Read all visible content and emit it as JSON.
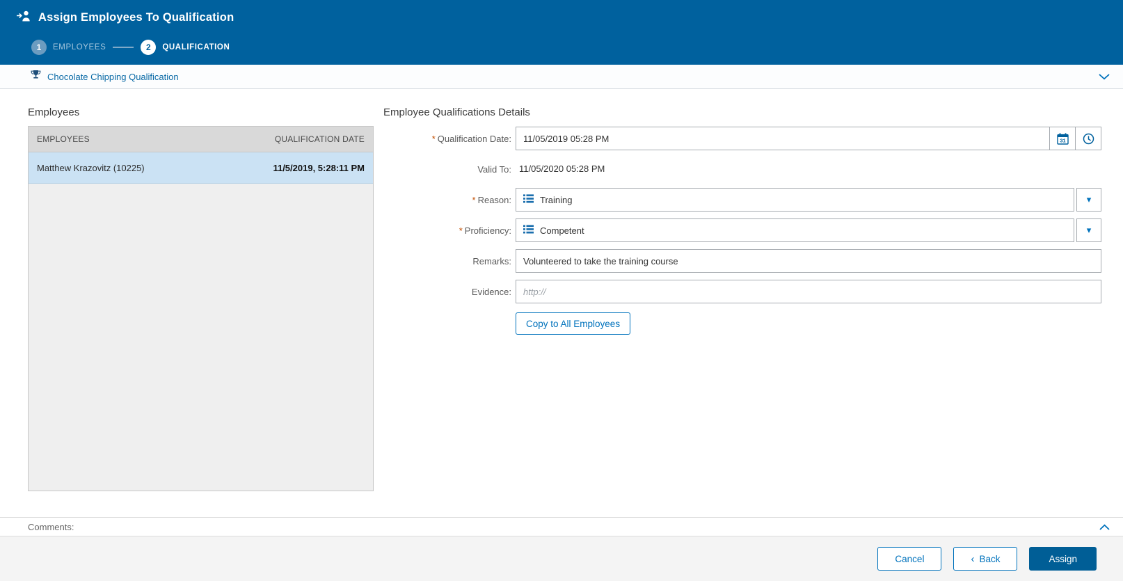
{
  "header": {
    "title": "Assign Employees To Qualification",
    "steps": [
      {
        "number": "1",
        "label": "EMPLOYEES"
      },
      {
        "number": "2",
        "label": "QUALIFICATION"
      }
    ]
  },
  "qualification_bar": {
    "title": "Chocolate Chipping Qualification"
  },
  "employees_panel": {
    "title": "Employees",
    "columns": [
      "EMPLOYEES",
      "QUALIFICATION DATE"
    ],
    "rows": [
      {
        "name": "Matthew Krazovitz (10225)",
        "date": "11/5/2019, 5:28:11 PM"
      }
    ]
  },
  "details_panel": {
    "title": "Employee Qualifications Details",
    "required_mark": "*",
    "qualification_date": {
      "label": "Qualification Date:",
      "value": "11/05/2019 05:28 PM"
    },
    "valid_to": {
      "label": "Valid To:",
      "value": "11/05/2020 05:28 PM"
    },
    "reason": {
      "label": "Reason:",
      "value": "Training"
    },
    "proficiency": {
      "label": "Proficiency:",
      "value": "Competent"
    },
    "remarks": {
      "label": "Remarks:",
      "value": "Volunteered to take the training course"
    },
    "evidence": {
      "label": "Evidence:",
      "placeholder": "http://"
    },
    "copy_button": "Copy to All Employees"
  },
  "comments": {
    "label": "Comments:"
  },
  "footer": {
    "cancel": "Cancel",
    "back": "Back",
    "assign": "Assign"
  },
  "icons": {
    "calendar_day": "31",
    "chevron_left": "‹",
    "caret_down": "▾"
  },
  "colors": {
    "header_bg": "#00619E",
    "accent": "#0072BC",
    "primary_button": "#005E96",
    "selected_row": "#CBE2F4",
    "required": "#C24E00"
  }
}
